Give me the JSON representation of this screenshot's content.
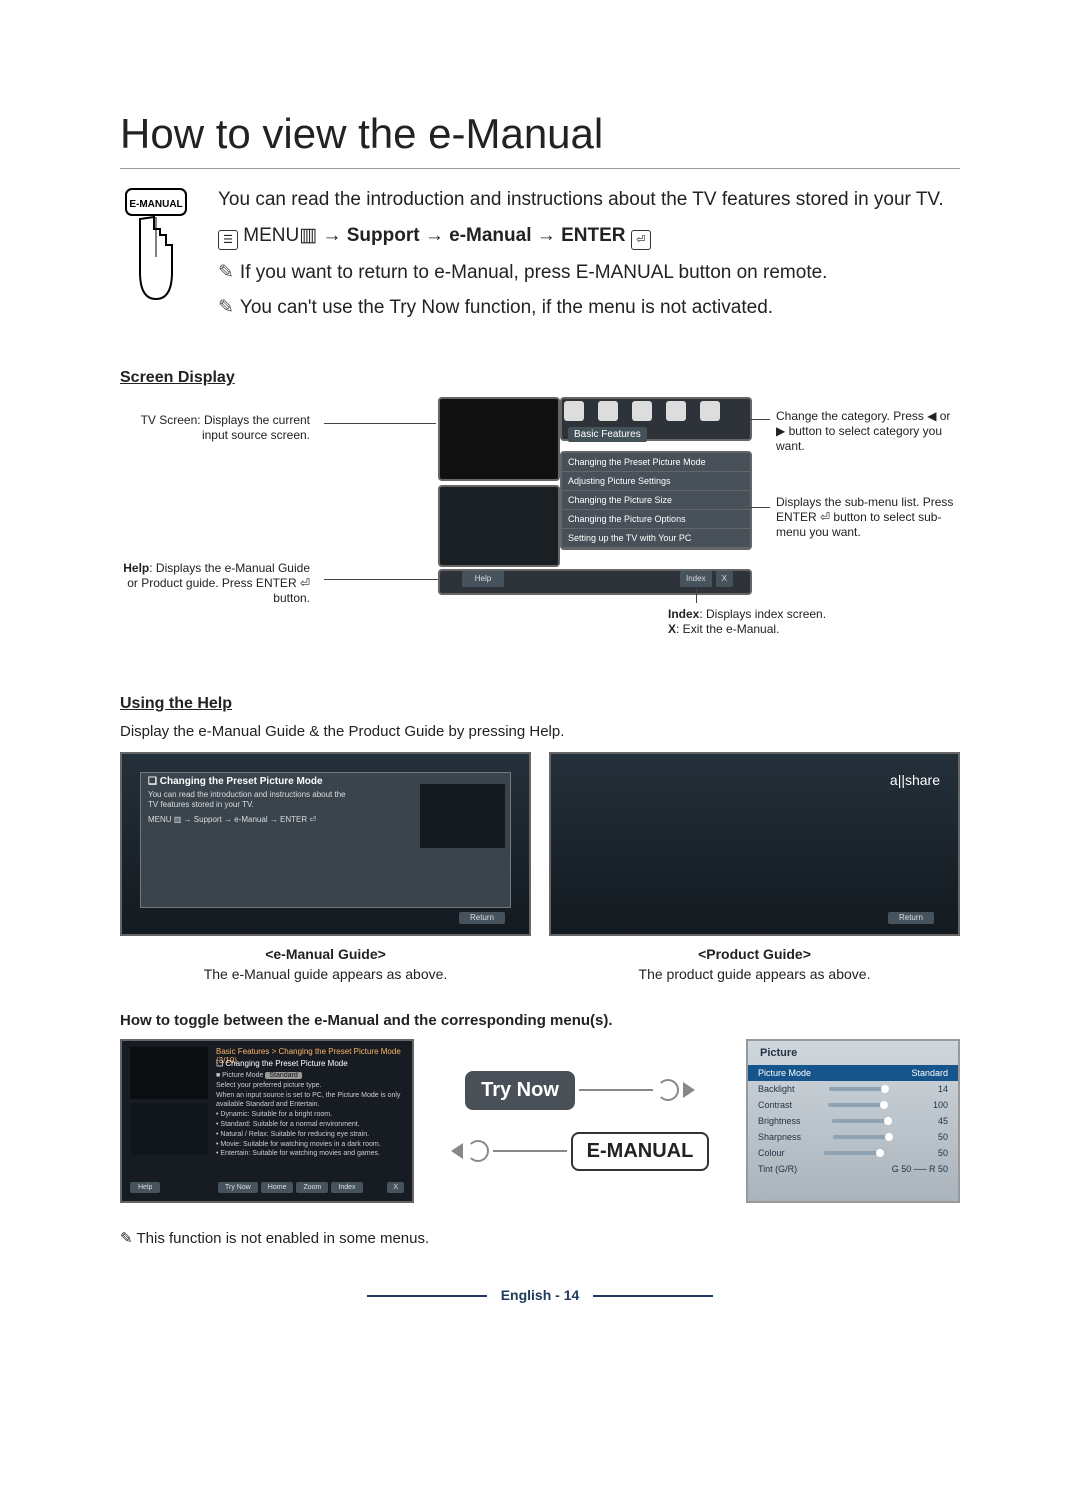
{
  "title": "How to view the e-Manual",
  "remote_button_label": "E-MANUAL",
  "intro": {
    "line1": "You can read the introduction and instructions about the TV features stored in your TV.",
    "nav_prefix": "MENU",
    "nav_path_1": "Support",
    "nav_path_2": "e-Manual",
    "nav_enter": "ENTER",
    "note1": "If you want to return to e-Manual, press E-MANUAL button on remote.",
    "note2": "You can't use the Try Now function, if the menu is not activated."
  },
  "screen_display": {
    "heading": "Screen Display",
    "callout_tv": "TV Screen: Displays the current input source screen.",
    "callout_category": "Change the category. Press ◀ or ▶ button to select category you want.",
    "callout_submenu": "Displays the sub-menu list. Press ENTER ⏎ button to select sub-menu you want.",
    "callout_help_pre": "Help",
    "callout_help_rest": ": Displays the e-Manual Guide or Product guide. Press ENTER ⏎ button.",
    "callout_index": "Index: Displays index screen.",
    "callout_x": "X: Exit the e-Manual.",
    "category_label": "Basic Features",
    "submenu": [
      "Changing the Preset Picture Mode",
      "Adjusting Picture Settings",
      "Changing the Picture Size",
      "Changing the Picture Options",
      "Setting up the TV with Your PC"
    ],
    "help_btn": "Help",
    "index_btn": "Index",
    "x_btn": "X"
  },
  "using_help": {
    "heading": "Using the Help",
    "desc": "Display the e-Manual Guide & the Product Guide by pressing Help.",
    "shot1_title": "❏ Changing the Preset Picture Mode",
    "shot1_body": "You can read the introduction and instructions about the TV features stored in your TV.",
    "shot1_nav": "MENU ▥ → Support → e-Manual → ENTER ⏎",
    "return_btn": "Return",
    "allshare": "a||share",
    "guide1_title": "<e-Manual Guide>",
    "guide1_desc": "The e-Manual guide appears as above.",
    "guide2_title": "<Product Guide>",
    "guide2_desc": "The product guide appears as above."
  },
  "toggle": {
    "heading": "How to toggle between the e-Manual and the corresponding menu(s).",
    "breadcrumb": "Basic Features > Changing the Preset Picture Mode (3/10)",
    "subheading": "❏ Changing the Preset Picture Mode",
    "pm_label": "■ Picture Mode",
    "pm_value": "Standard",
    "content_lines": [
      "Select your preferred picture type.",
      "When an input source is set to PC, the Picture Mode is only available Standard and Entertain.",
      "• Dynamic: Suitable for a bright room.",
      "• Standard: Suitable for a normal environment.",
      "• Natural / Relax: Suitable for reducing eye strain.",
      "• Movie: Suitable for watching movies in a dark room.",
      "• Entertain: Suitable for watching movies and games."
    ],
    "buttons": [
      "Try Now",
      "Home",
      "Zoom",
      "Index"
    ],
    "help_pill": "Help",
    "x_pill": "X",
    "try_now": "Try Now",
    "emanual": "E-MANUAL",
    "picture_panel": {
      "title": "Picture",
      "rows": [
        {
          "label": "Picture Mode",
          "value": "Standard",
          "selected": true
        },
        {
          "label": "Backlight",
          "value": "14"
        },
        {
          "label": "Contrast",
          "value": "100"
        },
        {
          "label": "Brightness",
          "value": "45"
        },
        {
          "label": "Sharpness",
          "value": "50"
        },
        {
          "label": "Colour",
          "value": "50"
        },
        {
          "label": "Tint (G/R)",
          "value": "G 50 ── R 50"
        }
      ]
    },
    "footer_note": "This function is not enabled in some menus."
  },
  "page_footer": "English - 14"
}
